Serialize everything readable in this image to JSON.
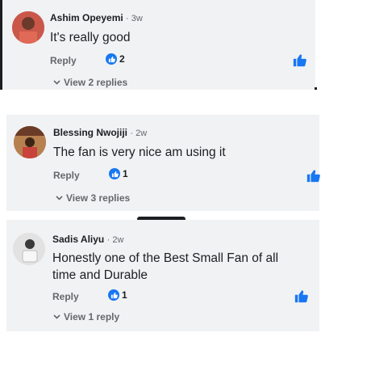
{
  "comments": [
    {
      "author": "Ashim Opeyemi",
      "time": "3w",
      "text": "It's really good",
      "reply_label": "Reply",
      "like_count": "2",
      "view_replies": "View 2 replies"
    },
    {
      "author": "Blessing Nwojiji",
      "time": "2w",
      "text": "The fan is very nice am using it",
      "reply_label": "Reply",
      "like_count": "1",
      "view_replies": "View 3 replies"
    },
    {
      "author": "Sadis Aliyu",
      "time": "2w",
      "text_line1": "Honestly one of the Best Small Fan of all",
      "text_line2": "time and Durable",
      "reply_label": "Reply",
      "like_count": "1",
      "view_replies": "View 1 reply"
    }
  ],
  "separator": "·",
  "colors": {
    "accent": "#1877f2",
    "card_bg": "#f1f2f4",
    "muted": "#65676b"
  },
  "icons": {
    "like_badge": "thumbs-up-icon",
    "like_button": "thumbs-up-icon",
    "chevron": "chevron-down-icon"
  }
}
